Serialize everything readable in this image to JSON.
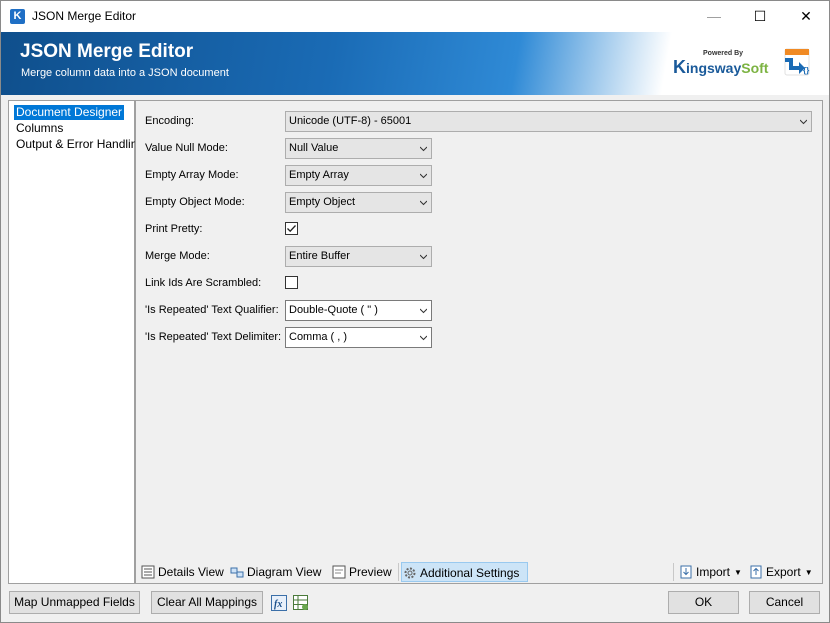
{
  "window": {
    "title": "JSON Merge Editor",
    "app_icon_letter": "K",
    "minimize_glyph": "—",
    "maximize_glyph": "☐",
    "close_glyph": "✕"
  },
  "banner": {
    "title": "JSON Merge Editor",
    "subtitle": "Merge column data into a JSON document",
    "brand_small": "Powered By",
    "brand_k": "K",
    "brand_ingsway": "ingsway",
    "brand_soft": "Soft",
    "product_icon": "json-document-icon"
  },
  "nav": {
    "items": [
      {
        "label": "Document Designer",
        "selected": true
      },
      {
        "label": "Columns",
        "selected": false
      },
      {
        "label": "Output & Error Handling",
        "selected": false
      }
    ]
  },
  "form": {
    "encoding": {
      "label": "Encoding:",
      "value": "Unicode (UTF-8) - 65001"
    },
    "value_null_mode": {
      "label": "Value Null Mode:",
      "value": "Null Value"
    },
    "empty_array_mode": {
      "label": "Empty Array Mode:",
      "value": "Empty Array"
    },
    "empty_object_mode": {
      "label": "Empty Object Mode:",
      "value": "Empty Object"
    },
    "print_pretty": {
      "label": "Print Pretty:",
      "checked": true
    },
    "merge_mode": {
      "label": "Merge Mode:",
      "value": "Entire Buffer"
    },
    "link_ids_scrambled": {
      "label": "Link Ids Are Scrambled:",
      "checked": false
    },
    "text_qualifier": {
      "label": "'Is Repeated' Text Qualifier:",
      "value": "Double-Quote ( \" )"
    },
    "text_delimiter": {
      "label": "'Is Repeated' Text Delimiter:",
      "value": "Comma ( , )"
    }
  },
  "tabs": {
    "details_view": "Details View",
    "diagram_view": "Diagram View",
    "preview": "Preview",
    "additional_settings": "Additional Settings",
    "import": "Import",
    "export": "Export",
    "active": "additional_settings"
  },
  "footer": {
    "map_unmapped": "Map Unmapped Fields",
    "clear_all": "Clear All Mappings",
    "ok": "OK",
    "cancel": "Cancel"
  },
  "colors": {
    "selection": "#0078d7",
    "banner_dark": "#0f4f8c",
    "banner_light": "#2f8ad6",
    "active_tab": "#cce4f7"
  }
}
